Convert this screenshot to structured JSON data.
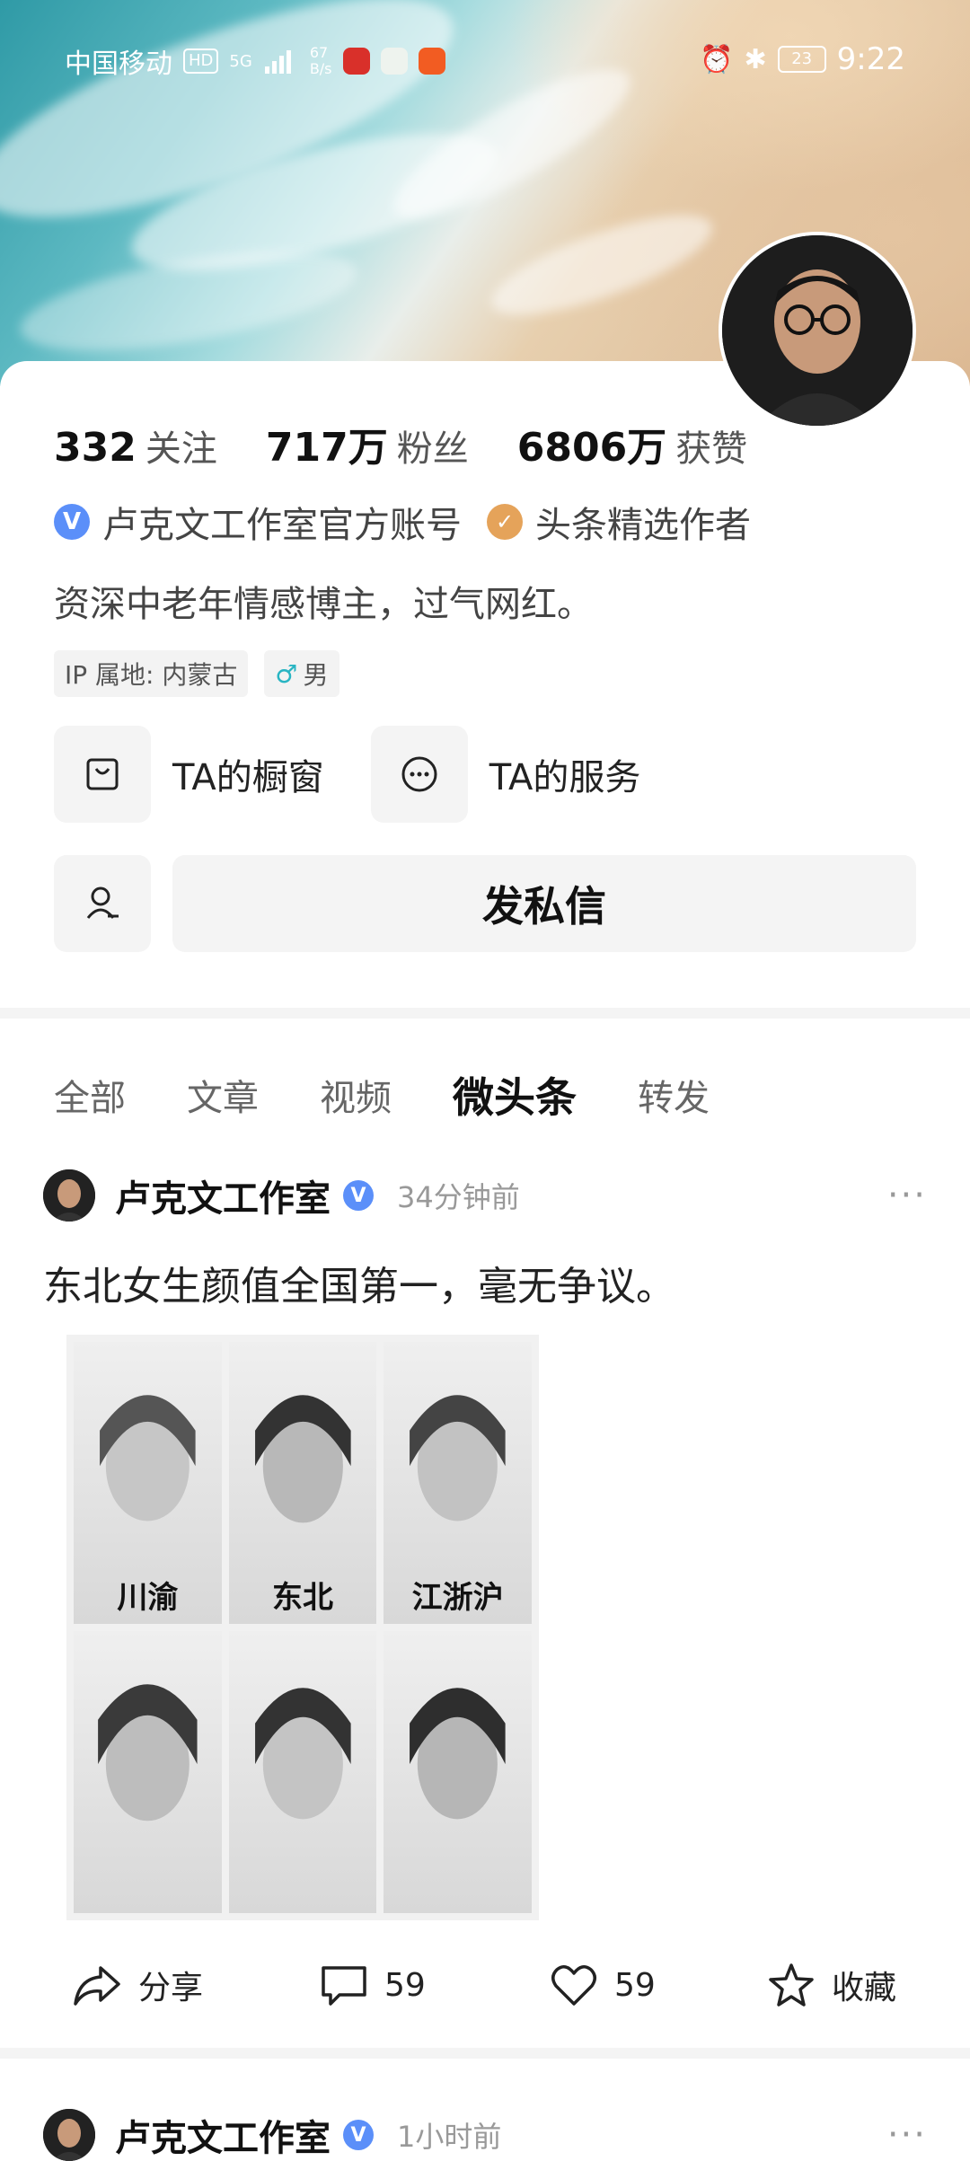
{
  "status": {
    "carrier": "中国移动",
    "hd": "HD",
    "net": "5G",
    "speed_value": "67",
    "speed_unit": "B/s",
    "battery": "23",
    "time": "9:22"
  },
  "profile": {
    "stats": [
      {
        "num": "332",
        "label": "关注"
      },
      {
        "num": "717万",
        "label": "粉丝"
      },
      {
        "num": "6806万",
        "label": "获赞"
      }
    ],
    "verified_text": "卢克文工作室官方账号",
    "author_badge_text": "头条精选作者",
    "bio": "资深中老年情感博主，过气网红。",
    "ip_tag": "IP 属地: 内蒙古",
    "gender_tag": "男",
    "services": [
      {
        "label": "TA的橱窗",
        "icon": "shop-bag-icon"
      },
      {
        "label": "TA的服务",
        "icon": "more-circle-icon"
      }
    ],
    "message_button": "发私信"
  },
  "tabs": [
    "全部",
    "文章",
    "视频",
    "微头条",
    "转发"
  ],
  "active_tab": "微头条",
  "posts": [
    {
      "author": "卢克文工作室",
      "time": "34分钟前",
      "text": "东北女生颜值全国第一，毫无争议。",
      "image_labels": [
        "川渝",
        "东北",
        "江浙沪"
      ],
      "actions": {
        "share": "分享",
        "comments": "59",
        "likes": "59",
        "favorite": "收藏"
      }
    },
    {
      "author": "卢克文工作室",
      "time": "1小时前"
    }
  ],
  "colors": {
    "verified_blue": "#5b8ff9",
    "author_gold": "#e5a35a"
  }
}
